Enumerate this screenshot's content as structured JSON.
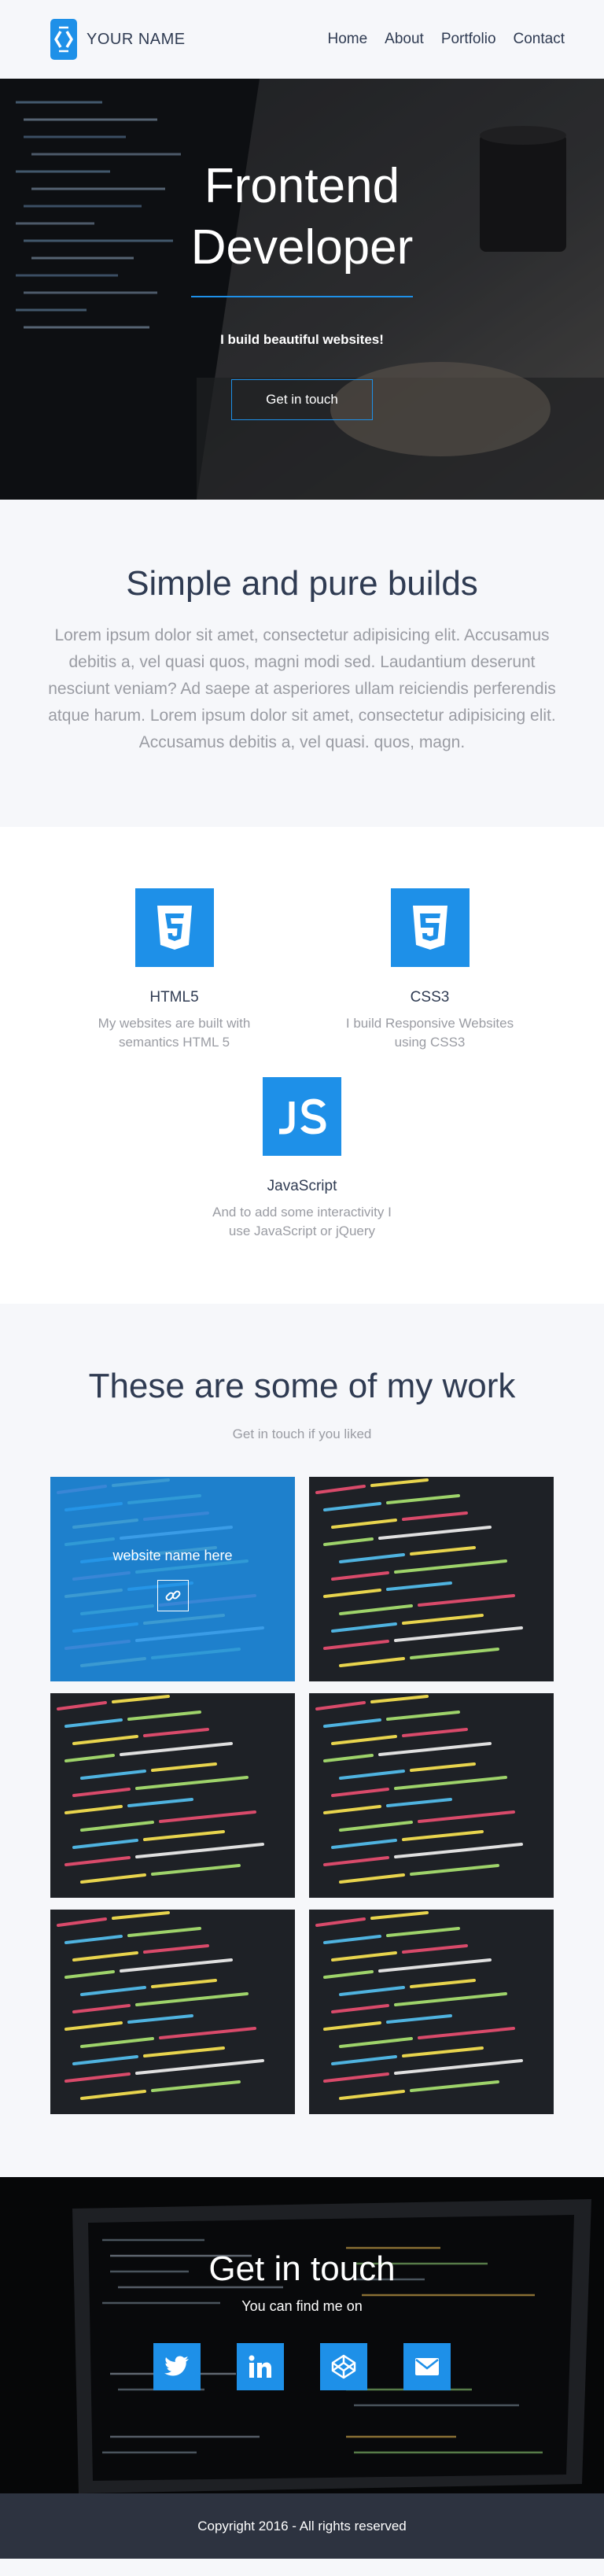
{
  "nav": {
    "brand": "YOUR NAME",
    "items": [
      {
        "label": "Home"
      },
      {
        "label": "About"
      },
      {
        "label": "Portfolio"
      },
      {
        "label": "Contact"
      }
    ]
  },
  "hero": {
    "title_line1": "Frontend",
    "title_line2": "Developer",
    "subtitle": "I build beautiful websites!",
    "cta": "Get in touch"
  },
  "intro": {
    "title": "Simple and pure builds",
    "body": "Lorem ipsum dolor sit amet, consectetur adipisicing elit. Accusamus debitis a, vel quasi quos, magni modi sed. Laudantium deserunt nesciunt veniam? Ad saepe at asperiores ullam reiciendis perferendis atque harum. Lorem ipsum dolor sit amet, consectetur adipisicing elit. Accusamus debitis a, vel quasi. quos, magn."
  },
  "skills": [
    {
      "icon": "html5-icon",
      "title": "HTML5",
      "desc": "My websites are built with semantics HTML 5"
    },
    {
      "icon": "css3-icon",
      "title": "CSS3",
      "desc": "I build Responsive Websites using CSS3"
    },
    {
      "icon": "javascript-icon",
      "title": "JavaScript",
      "desc": "And to add some interactivity I use JavaScript or jQuery"
    }
  ],
  "work": {
    "title": "These are some of my work",
    "subtitle": "Get in touch if you liked",
    "overlay_title": "website name here"
  },
  "contact": {
    "title": "Get in touch",
    "subtitle": "You can find me on",
    "socials": [
      "twitter-icon",
      "linkedin-icon",
      "codepen-icon",
      "email-icon"
    ]
  },
  "footer": {
    "copyright": "Copyright 2016 - All rights reserved"
  },
  "colors": {
    "accent": "#1e90e8",
    "text": "#2f3b52",
    "muted": "#9a9ca3",
    "footer_bg": "#2d3340"
  }
}
